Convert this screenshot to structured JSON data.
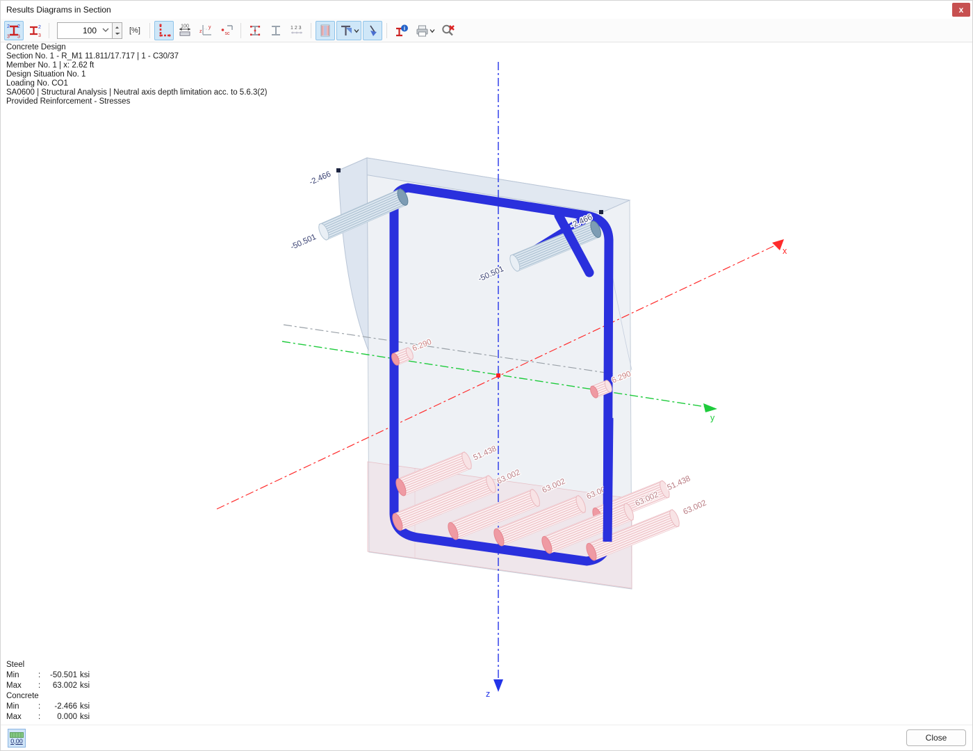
{
  "window": {
    "title": "Results Diagrams in Section",
    "close_glyph": "x"
  },
  "toolbar": {
    "scale_value": "100",
    "percent_label": "[%]",
    "glyphs": {
      "two": "2",
      "three": "3",
      "hundred": "100",
      "y": "y",
      "z": "z",
      "sc": "sc",
      "numbers": "1 2 3",
      "i": "i"
    }
  },
  "info": {
    "lines": [
      "Concrete Design",
      "Section No. 1 - R_M1 11.811/17.717 | 1 - C30/37",
      "Member No. 1 | x: 2.62 ft",
      "Design Situation No. 1",
      "Loading No. CO1",
      "SA0600 | Structural Analysis | Neutral axis depth limitation acc. to 5.6.3(2)",
      "Provided Reinforcement - Stresses"
    ]
  },
  "legend": {
    "steel_header": "Steel",
    "concrete_header": "Concrete",
    "colon": ":",
    "rows": [
      {
        "label": "Min",
        "number": "-50.501",
        "unit": "ksi"
      },
      {
        "label": "Max",
        "number": "63.002",
        "unit": "ksi"
      },
      {
        "label": "Min",
        "number": "-2.466",
        "unit": "ksi"
      },
      {
        "label": "Max",
        "number": "0.000",
        "unit": "ksi"
      }
    ]
  },
  "scene": {
    "axis": {
      "x": "x",
      "y": "y",
      "z": "z"
    },
    "labels": {
      "concrete_top_left": "-2.466",
      "concrete_top_right": "-2.466",
      "steel_top_left": "-50.501",
      "steel_top_right": "-50.501",
      "steel_mid_left": "6.290",
      "steel_mid_right": "6.290",
      "steel_layer2_left": "51.438",
      "steel_layer2_right": "51.438",
      "steel_bottom_1": "63.002",
      "steel_bottom_2": "63.002",
      "steel_bottom_3": "63.002",
      "steel_bottom_out_top": "63.002",
      "steel_bottom_out_bottom": "63.002"
    },
    "colors": {
      "stirrup": "#2a30dd",
      "axis_x": "#ff2b2b",
      "axis_y": "#1ecb3c",
      "axis_z": "#2334e8",
      "compression_label": "#3a4273",
      "tension_label": "#b97b82",
      "concrete_face": "#eef1f5",
      "tension_zone": "#f3ced3"
    }
  },
  "footer": {
    "decimals": "0,00",
    "close_label": "Close"
  }
}
